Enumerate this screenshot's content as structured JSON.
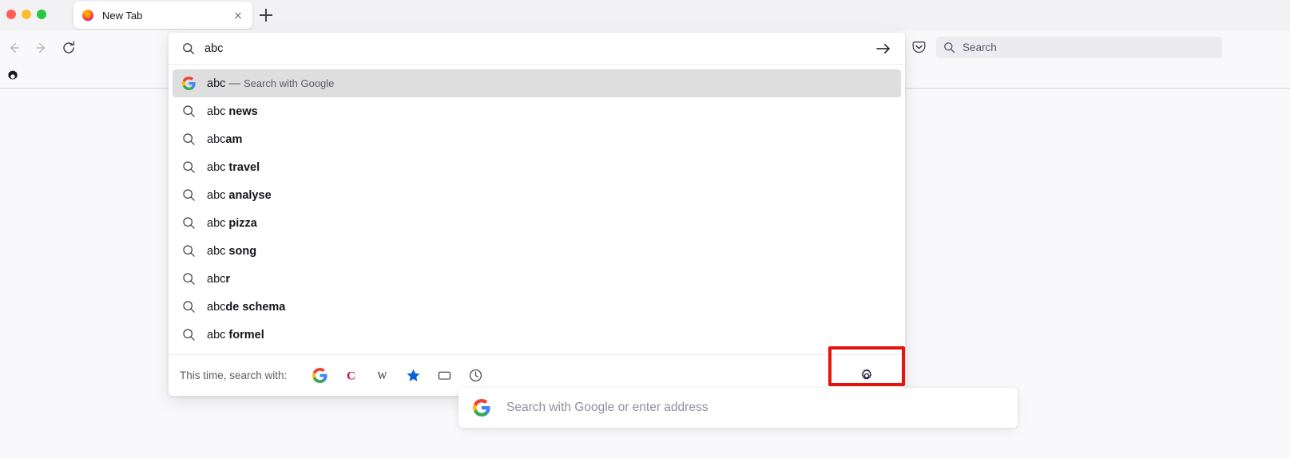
{
  "window": {
    "traffic_lights": [
      "close",
      "minimize",
      "zoom"
    ],
    "colors": {
      "close": "#ff5f57",
      "minimize": "#febc2e",
      "zoom": "#28c840",
      "accent_highlight": "#e8120f",
      "selected_row_bg": "#dededf"
    }
  },
  "tabbar": {
    "tab_title": "New Tab",
    "favicon": "firefox-icon",
    "close_icon": "close-icon",
    "new_tab_icon": "plus-icon"
  },
  "navbar": {
    "back_icon": "back-arrow-icon",
    "forward_icon": "forward-arrow-icon",
    "reload_icon": "reload-icon"
  },
  "bookmarks_bar": {
    "gear_icon": "gear-icon"
  },
  "toolbar_right": {
    "pocket_icon": "pocket-icon",
    "search_icon": "search-icon",
    "search_placeholder": "Search",
    "search_value": ""
  },
  "urlbar": {
    "search_icon": "search-icon",
    "value": "abc",
    "go_icon": "arrow-right-icon",
    "results": [
      {
        "icon": "google-icon",
        "text": "abc",
        "bold": "",
        "separator": " — ",
        "engine": "Search with Google",
        "selected": true
      },
      {
        "icon": "search-icon",
        "text": "abc ",
        "bold": "news",
        "selected": false
      },
      {
        "icon": "search-icon",
        "text": "abc",
        "bold": "am",
        "selected": false
      },
      {
        "icon": "search-icon",
        "text": "abc ",
        "bold": "travel",
        "selected": false
      },
      {
        "icon": "search-icon",
        "text": "abc ",
        "bold": "analyse",
        "selected": false
      },
      {
        "icon": "search-icon",
        "text": "abc ",
        "bold": "pizza",
        "selected": false
      },
      {
        "icon": "search-icon",
        "text": "abc ",
        "bold": "song",
        "selected": false
      },
      {
        "icon": "search-icon",
        "text": "abc",
        "bold": "r",
        "selected": false
      },
      {
        "icon": "search-icon",
        "text": "abc",
        "bold": "de schema",
        "selected": false
      },
      {
        "icon": "search-icon",
        "text": "abc ",
        "bold": "formel",
        "selected": false
      }
    ],
    "footer": {
      "label": "This time, search with:",
      "engines": [
        {
          "name": "google",
          "icon": "google-icon",
          "color": "#4285f4"
        },
        {
          "name": "qwant",
          "icon": "letter-c-icon",
          "color": "#c5093b"
        },
        {
          "name": "wikipedia",
          "icon": "wikipedia-w-icon",
          "color": "#202122"
        },
        {
          "name": "bookmarks",
          "icon": "star-icon",
          "color": "#0a63d6"
        },
        {
          "name": "tabs",
          "icon": "tab-rectangle-icon",
          "color": "#42414d"
        },
        {
          "name": "history",
          "icon": "clock-icon",
          "color": "#42414d"
        }
      ],
      "settings_icon": "gear-icon"
    }
  },
  "newtab_page": {
    "search_logo": "google-icon",
    "search_placeholder": "Search with Google or enter address",
    "search_value": ""
  }
}
